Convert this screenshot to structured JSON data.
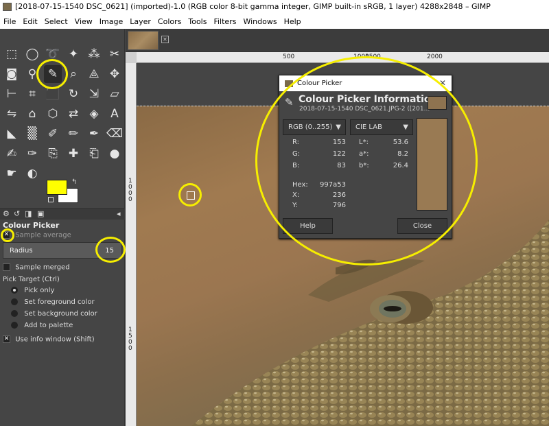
{
  "window": {
    "title": "[2018-07-15-1540 DSC_0621] (imported)-1.0 (RGB color 8-bit gamma integer, GIMP built-in sRGB, 1 layer) 4288x2848 – GIMP"
  },
  "menubar": [
    "File",
    "Edit",
    "Select",
    "View",
    "Image",
    "Layer",
    "Colors",
    "Tools",
    "Filters",
    "Windows",
    "Help"
  ],
  "tool_icons": [
    "rect-select",
    "ellipse-select",
    "free-select",
    "fuzzy-select",
    "by-color-select",
    "scissors-select",
    "foreground-select",
    "paths",
    "color-picker",
    "zoom",
    "measure",
    "move",
    "align",
    "crop",
    "unified-transform",
    "rotate",
    "scale",
    "shear",
    "flip",
    "perspective",
    "cage-transform",
    "warp-transform",
    "handle-transform",
    "text",
    "bucket-fill",
    "gradient",
    "paintbrush",
    "pencil",
    "airbrush",
    "eraser",
    "ink",
    "mypaint-brush",
    "clone",
    "heal",
    "perspective-clone",
    "blur-sharpen",
    "smudge",
    "dodge-burn"
  ],
  "fg_color": "#ffff00",
  "bg_color": "#ffffff",
  "tool_options": {
    "title": "Colour Picker",
    "sample_average": "Sample average",
    "radius_label": "Radius",
    "radius_value": "15",
    "sample_merged": "Sample merged",
    "pick_target": "Pick Target  (Ctrl)",
    "targets": [
      "Pick only",
      "Set foreground color",
      "Set background color",
      "Add to palette"
    ],
    "use_info_window": "Use info window  (Shift)"
  },
  "rulers": {
    "h_ticks": [
      "500",
      "1000",
      "1500",
      "2000"
    ],
    "v_ticks": [
      "1000",
      "1500"
    ]
  },
  "dialog": {
    "title": "Colour Picker",
    "heading": "Colour Picker Information",
    "subtitle": "2018-07-15-1540 DSC_0621.JPG-2 ([201...",
    "left_mode": "RGB (0..255)",
    "right_mode": "CIE LAB",
    "rgb": [
      {
        "k": "R:",
        "v": "153"
      },
      {
        "k": "G:",
        "v": "122"
      },
      {
        "k": "B:",
        "v": "83"
      }
    ],
    "lab": [
      {
        "k": "L*:",
        "v": "53.6"
      },
      {
        "k": "a*:",
        "v": "8.2"
      },
      {
        "k": "b*:",
        "v": "26.4"
      }
    ],
    "info": [
      {
        "k": "Hex:",
        "v": "997a53"
      },
      {
        "k": "X:",
        "v": "236"
      },
      {
        "k": "Y:",
        "v": "796"
      }
    ],
    "swatch_color": "#997a53",
    "help": "Help",
    "close": "Close"
  },
  "highlight_color": "#f6ee00"
}
